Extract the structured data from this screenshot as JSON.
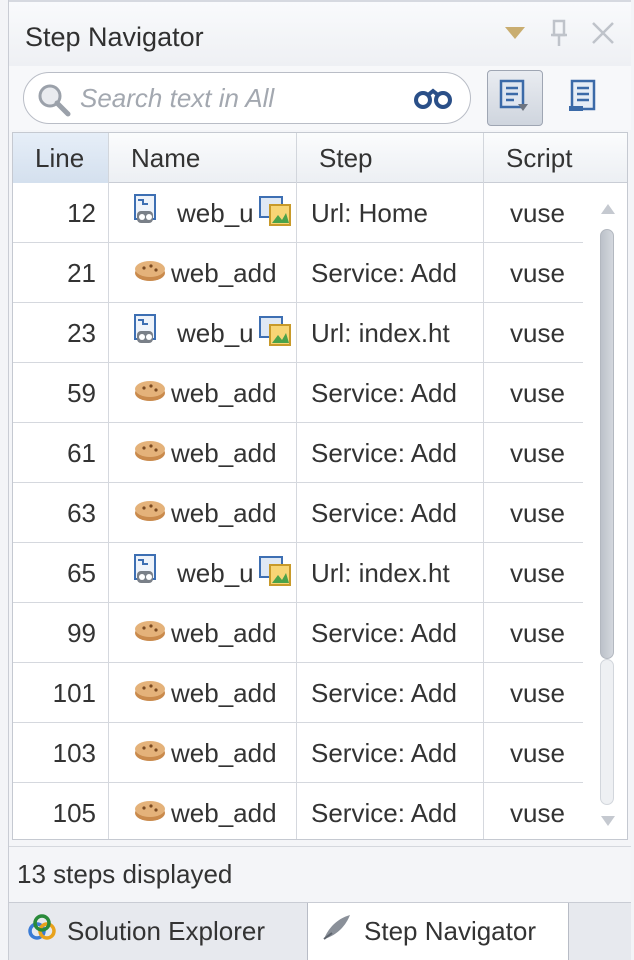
{
  "panel": {
    "title": "Step Navigator"
  },
  "search": {
    "placeholder": "Search text in All"
  },
  "grid": {
    "columns": [
      "Line",
      "Name",
      "Step",
      "Script"
    ],
    "rows": [
      {
        "line": "12",
        "name": "web_u",
        "step": "Url: Home",
        "script": "vuse",
        "kind": "url"
      },
      {
        "line": "21",
        "name": "web_add",
        "step": "Service: Add",
        "script": "vuse",
        "kind": "service"
      },
      {
        "line": "23",
        "name": "web_u",
        "step": "Url: index.ht",
        "script": "vuse",
        "kind": "url"
      },
      {
        "line": "59",
        "name": "web_add",
        "step": "Service: Add",
        "script": "vuse",
        "kind": "service"
      },
      {
        "line": "61",
        "name": "web_add",
        "step": "Service: Add",
        "script": "vuse",
        "kind": "service"
      },
      {
        "line": "63",
        "name": "web_add",
        "step": "Service: Add",
        "script": "vuse",
        "kind": "service"
      },
      {
        "line": "65",
        "name": "web_u",
        "step": "Url: index.ht",
        "script": "vuse",
        "kind": "url"
      },
      {
        "line": "99",
        "name": "web_add",
        "step": "Service: Add",
        "script": "vuse",
        "kind": "service"
      },
      {
        "line": "101",
        "name": "web_add",
        "step": "Service: Add",
        "script": "vuse",
        "kind": "service"
      },
      {
        "line": "103",
        "name": "web_add",
        "step": "Service: Add",
        "script": "vuse",
        "kind": "service"
      },
      {
        "line": "105",
        "name": "web_add",
        "step": "Service: Add",
        "script": "vuse",
        "kind": "service"
      }
    ]
  },
  "status": {
    "text": "13 steps displayed"
  },
  "tabs": [
    {
      "label": "Solution Explorer",
      "icon": "solution-explorer-icon"
    },
    {
      "label": "Step Navigator",
      "icon": "step-navigator-icon",
      "active": true
    }
  ],
  "icons": {
    "title_actions": [
      "dropdown-icon",
      "pin-icon",
      "close-icon"
    ],
    "toolbar": [
      "search-icon",
      "binoculars-icon",
      "filter-view-icon",
      "script-view-icon"
    ]
  },
  "colors": {
    "accent": "#4a78b8",
    "active_header": "#d4e0ee",
    "cookie": "#c98a4c"
  }
}
